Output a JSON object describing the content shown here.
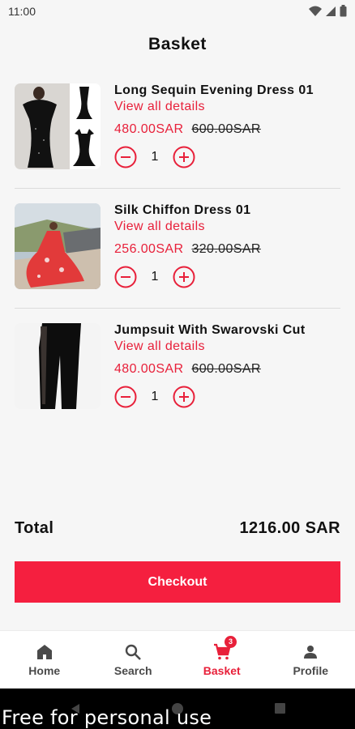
{
  "status_bar": {
    "time": "11:00",
    "icons": [
      "wifi-icon",
      "signal-icon",
      "battery-icon"
    ]
  },
  "header": {
    "title": "Basket"
  },
  "cart": {
    "items": [
      {
        "name": "Long Sequin Evening Dress 01",
        "details_link": "View all details",
        "price": "480.00SAR",
        "old_price": "600.00SAR",
        "quantity": "1"
      },
      {
        "name": "Silk Chiffon Dress 01",
        "details_link": "View all details",
        "price": "256.00SAR",
        "old_price": "320.00SAR",
        "quantity": "1"
      },
      {
        "name": "Jumpsuit With Swarovski Cut",
        "details_link": "View all details",
        "price": "480.00SAR",
        "old_price": "600.00SAR",
        "quantity": "1"
      }
    ],
    "total_label": "Total",
    "total_value": "1216.00 SAR",
    "checkout_label": "Checkout"
  },
  "bottom_nav": {
    "items": [
      {
        "label": "Home",
        "icon": "home-icon"
      },
      {
        "label": "Search",
        "icon": "search-icon"
      },
      {
        "label": "Basket",
        "icon": "cart-icon",
        "badge": "3",
        "active": true
      },
      {
        "label": "Profile",
        "icon": "person-icon"
      }
    ]
  },
  "watermark": "Free for personal use",
  "colors": {
    "accent": "#e8203a",
    "checkout": "#f51f3f",
    "background": "#f6f6f6"
  }
}
